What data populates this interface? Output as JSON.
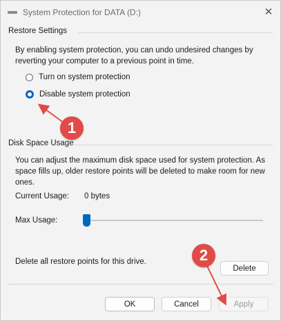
{
  "window": {
    "title": "System Protection for DATA (D:)"
  },
  "restore_settings": {
    "heading": "Restore Settings",
    "description_line1": "By enabling system protection, you can undo undesired changes by",
    "description_line2": "reverting your computer to a previous point in time.",
    "options": [
      {
        "label": "Turn on system protection",
        "checked": false
      },
      {
        "label": "Disable system protection",
        "checked": true
      }
    ]
  },
  "disk_space": {
    "heading": "Disk Space Usage",
    "description_line1": "You can adjust the maximum disk space used for system protection. As",
    "description_line2": "space fills up, older restore points will be deleted to make room for new",
    "description_line3": "ones.",
    "current_usage_label": "Current Usage:",
    "current_usage_value": "0 bytes",
    "max_usage_label": "Max Usage:",
    "max_usage_fraction": 0
  },
  "delete_section": {
    "text": "Delete all restore points for this drive.",
    "delete_label": "Delete"
  },
  "footer": {
    "ok_label": "OK",
    "cancel_label": "Cancel",
    "apply_label": "Apply"
  },
  "annotations": {
    "marker1": "1",
    "marker2": "2",
    "color": "#e04a47"
  }
}
